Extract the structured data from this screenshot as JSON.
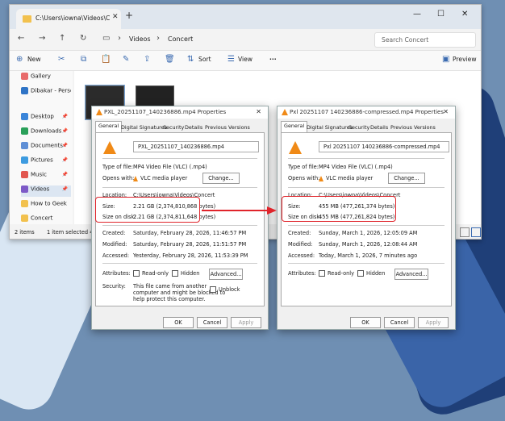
{
  "explorer": {
    "tab_title": "C:\\Users\\iowna\\Videos\\Concert",
    "breadcrumb": [
      "Videos",
      "Concert"
    ],
    "search_placeholder": "Search Concert",
    "toolbar": {
      "new": "New",
      "sort": "Sort",
      "view": "View",
      "more": "···",
      "preview": "Preview"
    },
    "sidebar": [
      {
        "label": "Gallery",
        "icon": "gallery-icon",
        "color": "#e86a6a"
      },
      {
        "label": "Dibakar - Perso",
        "icon": "cloud-icon",
        "color": "#2f74c6"
      },
      {
        "label": "Desktop",
        "icon": "desktop-icon",
        "color": "#3a85d9"
      },
      {
        "label": "Downloads",
        "icon": "download-icon",
        "color": "#2aa05a"
      },
      {
        "label": "Documents",
        "icon": "document-icon",
        "color": "#5e8fd6"
      },
      {
        "label": "Pictures",
        "icon": "picture-icon",
        "color": "#3d9be0"
      },
      {
        "label": "Music",
        "icon": "music-icon",
        "color": "#e2564f"
      },
      {
        "label": "Videos",
        "icon": "video-icon",
        "color": "#7d5ac7"
      },
      {
        "label": "How to Geek",
        "icon": "folder-icon",
        "color": "#f2c14e"
      },
      {
        "label": "Concert",
        "icon": "folder-icon",
        "color": "#f2c14e"
      }
    ],
    "status": {
      "items": "2 items",
      "selected": "1 item selected  455 M"
    }
  },
  "left_dialog": {
    "title": "PXL_20251107_140236886.mp4 Properties",
    "tabs": [
      "General",
      "Digital Signatures",
      "Security",
      "Details",
      "Previous Versions"
    ],
    "file_name": "PXL_20251107_140236886.mp4",
    "type_label": "Type of file:",
    "type_value": "MP4 Video File (VLC) (.mp4)",
    "opens_label": "Opens with:",
    "opens_value": "VLC media player",
    "change": "Change...",
    "location_label": "Location:",
    "location_value": "C:\\Users\\iowna\\Videos\\Concert",
    "size_label": "Size:",
    "size_value": "2.21 GB (2,374,810,868 bytes)",
    "disk_label": "Size on disk:",
    "disk_value": "2.21 GB (2,374,811,648 bytes)",
    "created_label": "Created:",
    "created_value": "Saturday, February 28, 2026, 11:46:57 PM",
    "modified_label": "Modified:",
    "modified_value": "Saturday, February 28, 2026, 11:51:57 PM",
    "accessed_label": "Accessed:",
    "accessed_value": "Yesterday, February 28, 2026, 11:53:39 PM",
    "attributes_label": "Attributes:",
    "readonly": "Read-only",
    "hidden": "Hidden",
    "advanced": "Advanced...",
    "security_label": "Security:",
    "security_text": [
      "This file came from another",
      "computer and might be blocked to",
      "help protect this computer."
    ],
    "unblock": "Unblock",
    "ok": "OK",
    "cancel": "Cancel",
    "apply": "Apply"
  },
  "right_dialog": {
    "title": "Pxl 20251107 140236886-compressed.mp4 Properties",
    "tabs": [
      "General",
      "Digital Signatures",
      "Security",
      "Details",
      "Previous Versions"
    ],
    "file_name": "Pxl 20251107 140236886-compressed.mp4",
    "type_label": "Type of file:",
    "type_value": "MP4 Video File (VLC) (.mp4)",
    "opens_label": "Opens with:",
    "opens_value": "VLC media player",
    "change": "Change...",
    "location_label": "Location:",
    "location_value": "C:\\Users\\iowna\\Videos\\Concert",
    "size_label": "Size:",
    "size_value": "455 MB (477,261,374 bytes)",
    "disk_label": "Size on disk:",
    "disk_value": "455 MB (477,261,824 bytes)",
    "created_label": "Created:",
    "created_value": "Sunday, March 1, 2026, 12:05:09 AM",
    "modified_label": "Modified:",
    "modified_value": "Sunday, March 1, 2026, 12:08:44 AM",
    "accessed_label": "Accessed:",
    "accessed_value": "Today, March 1, 2026, 7 minutes ago",
    "attributes_label": "Attributes:",
    "readonly": "Read-only",
    "hidden": "Hidden",
    "advanced": "Advanced...",
    "ok": "OK",
    "cancel": "Cancel",
    "apply": "Apply"
  },
  "colors": {
    "highlight": "#e0242b",
    "vlc": "#f08a17"
  }
}
